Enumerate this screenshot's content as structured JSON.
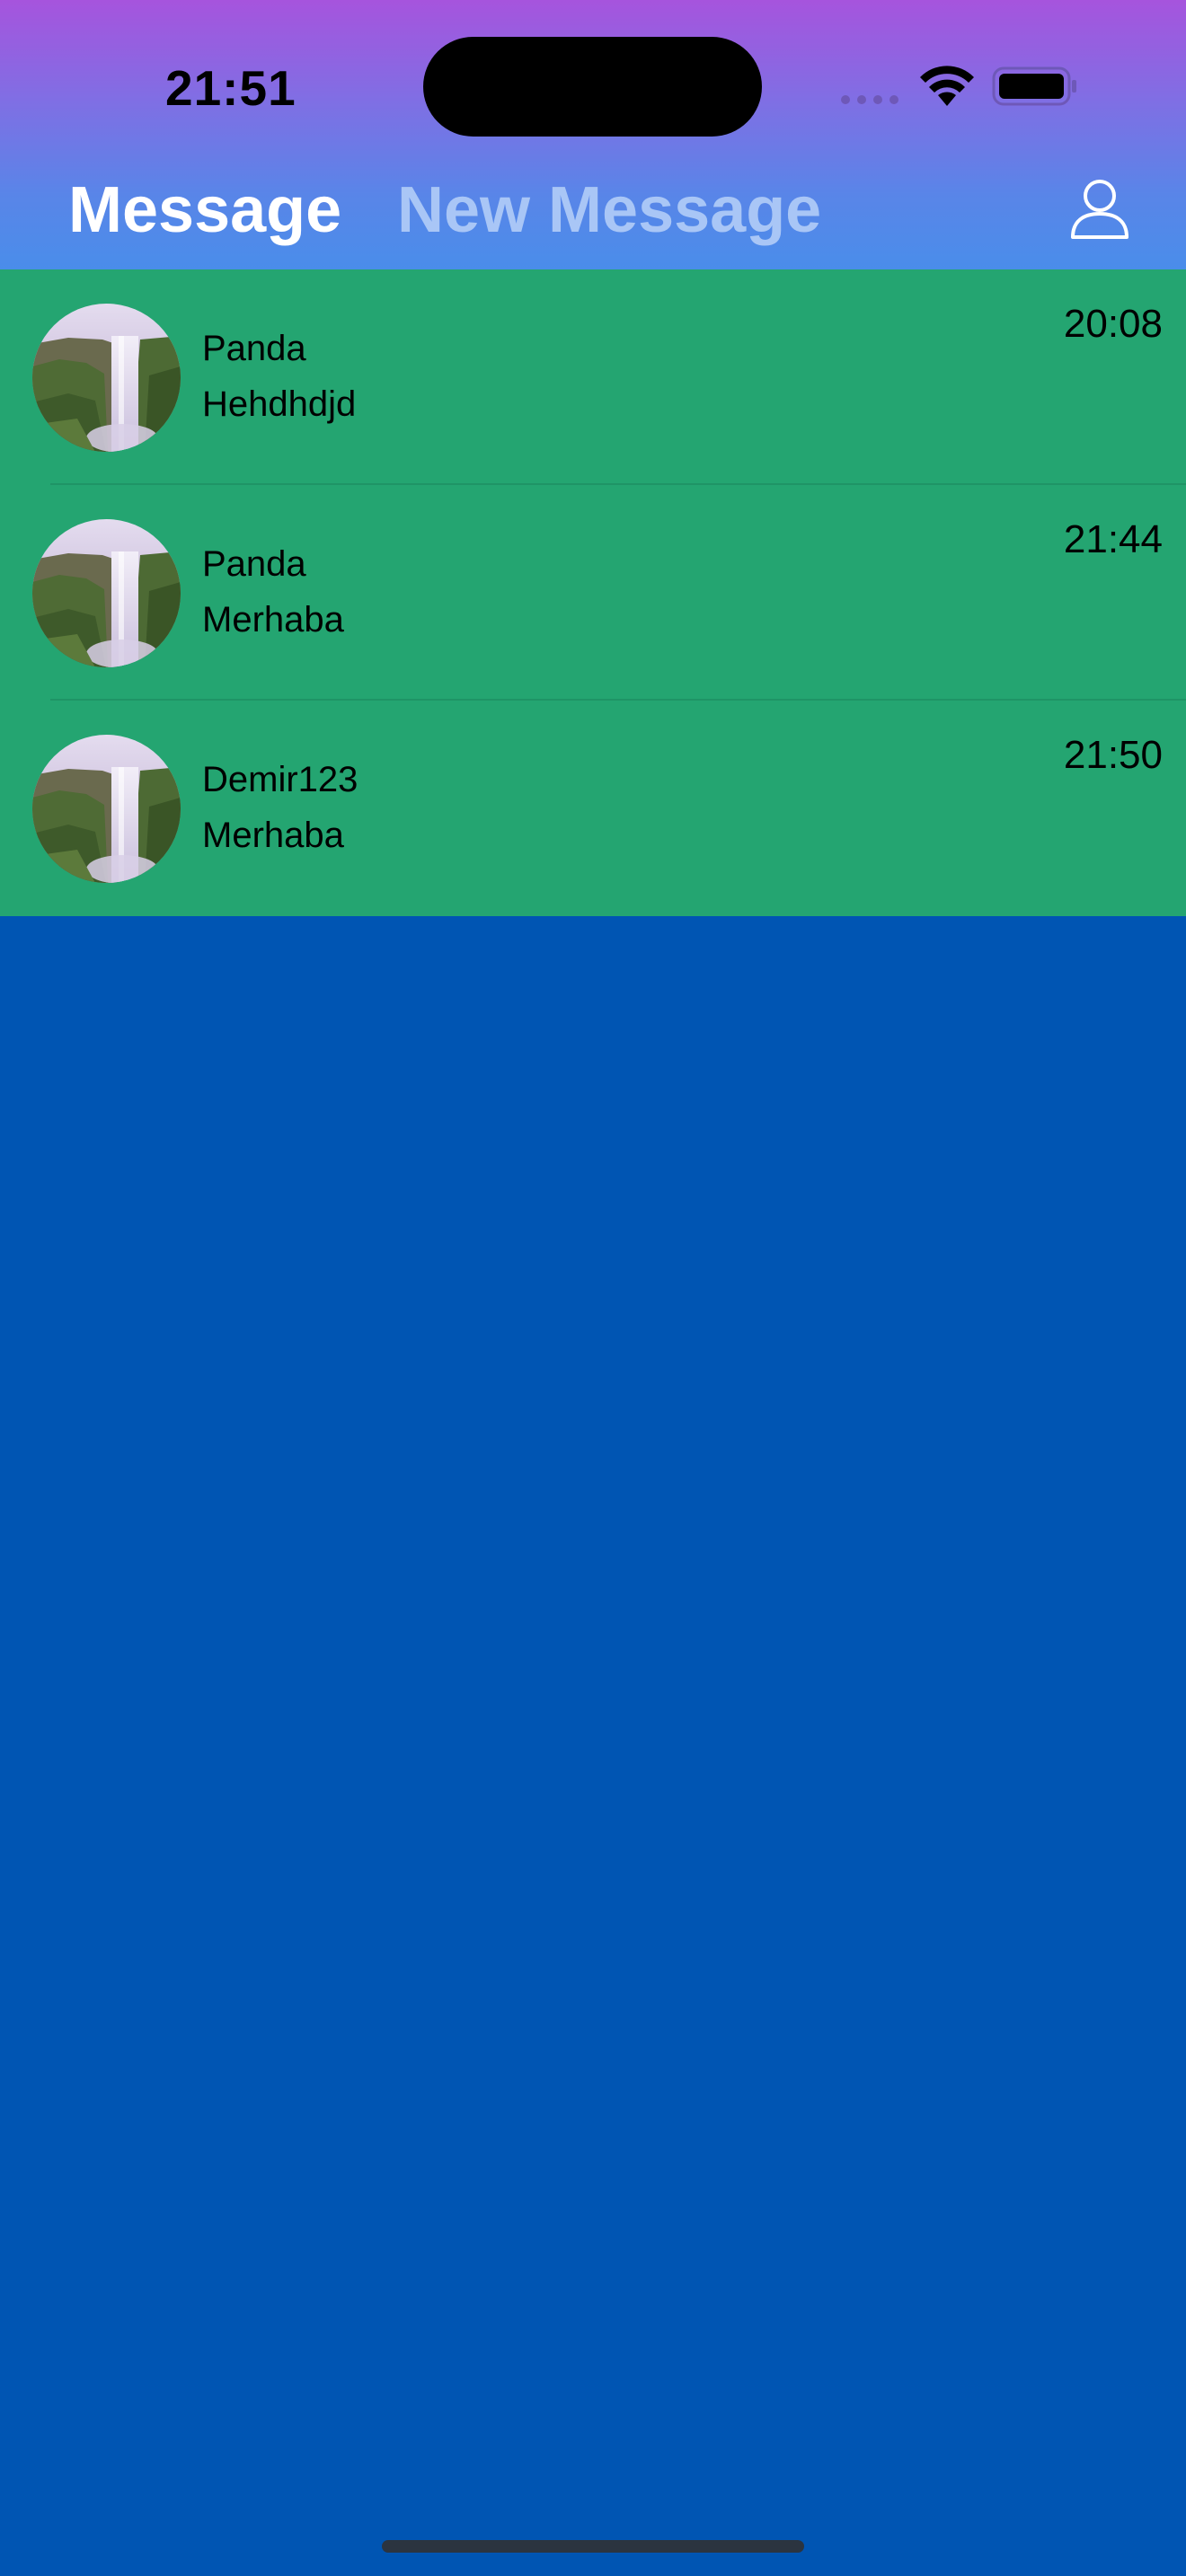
{
  "status_bar": {
    "time": "21:51",
    "icons": [
      "cellular-signal-icon",
      "wifi-icon",
      "battery-icon"
    ]
  },
  "header": {
    "tabs": [
      {
        "label": "Message",
        "active": true
      },
      {
        "label": "New Message",
        "active": false
      }
    ],
    "profile_icon": "person-icon"
  },
  "conversations": [
    {
      "name": "Panda",
      "preview": "Hehdhdjd",
      "time": "20:08",
      "avatar": "waterfall-image"
    },
    {
      "name": "Panda",
      "preview": "Merhaba",
      "time": "21:44",
      "avatar": "waterfall-image"
    },
    {
      "name": "Demir123",
      "preview": "Merhaba",
      "time": "21:50",
      "avatar": "waterfall-image"
    }
  ],
  "colors": {
    "header_gradient_top": "#A654DD",
    "header_gradient_bottom": "#4A8DEA",
    "list_background": "#24A571",
    "page_background": "#0055B3",
    "active_tab": "#FFFFFF",
    "inactive_tab": "#A9C6F6"
  }
}
